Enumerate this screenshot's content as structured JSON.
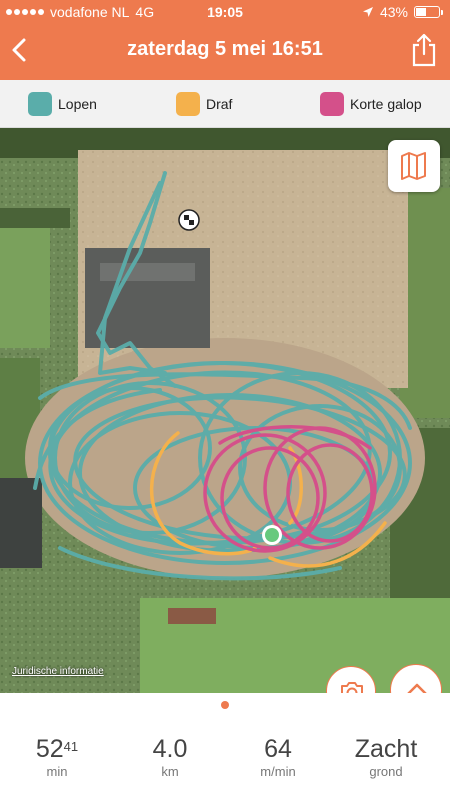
{
  "status_bar": {
    "carrier": "vodafone NL",
    "network": "4G",
    "time": "19:05",
    "battery": "43%"
  },
  "header": {
    "title": "zaterdag 5 mei 16:51",
    "back_icon": "chevron-left-icon",
    "share_icon": "share-icon"
  },
  "legend": [
    {
      "label": "Lopen",
      "color": "#5aadaa"
    },
    {
      "label": "Draf",
      "color": "#f4b14c"
    },
    {
      "label": "Korte galop",
      "color": "#d4508a"
    }
  ],
  "map": {
    "legal_link": "Juridische informatie",
    "map_toggle_icon": "map-icon"
  },
  "actions": {
    "camera_icon": "camera-icon",
    "expand_icon": "chevron-up-icon"
  },
  "stats": [
    {
      "value": "52",
      "sup": "41",
      "label": "min"
    },
    {
      "value": "4.0",
      "sup": "",
      "label": "km"
    },
    {
      "value": "64",
      "sup": "",
      "label": "m/min"
    },
    {
      "value": "Zacht",
      "sup": "",
      "label": "grond"
    }
  ],
  "colors": {
    "accent": "#ee7a4e"
  }
}
